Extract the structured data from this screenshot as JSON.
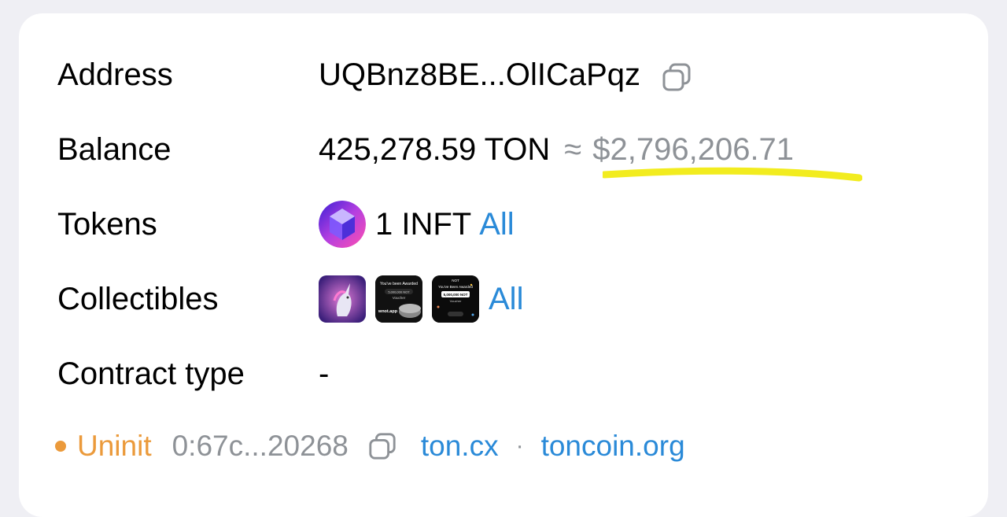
{
  "details": {
    "address": {
      "label": "Address",
      "value": "UQBnz8BE...OlICaPqz",
      "icon": "copy-icon"
    },
    "balance": {
      "label": "Balance",
      "amount": "425,278.59 TON",
      "approx": "≈",
      "fiat": "$2,796,206.71",
      "highlight_color": "#f2ec1f"
    },
    "tokens": {
      "label": "Tokens",
      "text": "1 INFT",
      "all_link": "All"
    },
    "collectibles": {
      "label": "Collectibles",
      "all_link": "All",
      "items": [
        {
          "name": "unicorn-nft",
          "text": ""
        },
        {
          "name": "not-voucher-nft-1",
          "title": "You've been Awarded",
          "amount": "5,000,000 NOT",
          "subtitle": "Voucher",
          "domain": "wnot.app"
        },
        {
          "name": "not-voucher-nft-2",
          "brand": "NOT",
          "title": "You've Been Awarded",
          "amount": "5,000,000 NOT",
          "subtitle": "Voucher"
        }
      ]
    },
    "contract_type": {
      "label": "Contract type",
      "value": "-"
    }
  },
  "footer": {
    "status": "Uninit",
    "status_color": "#eb9a3b",
    "hash": "0:67c...20268",
    "link1": "ton.cx",
    "separator": "·",
    "link2": "toncoin.org"
  }
}
